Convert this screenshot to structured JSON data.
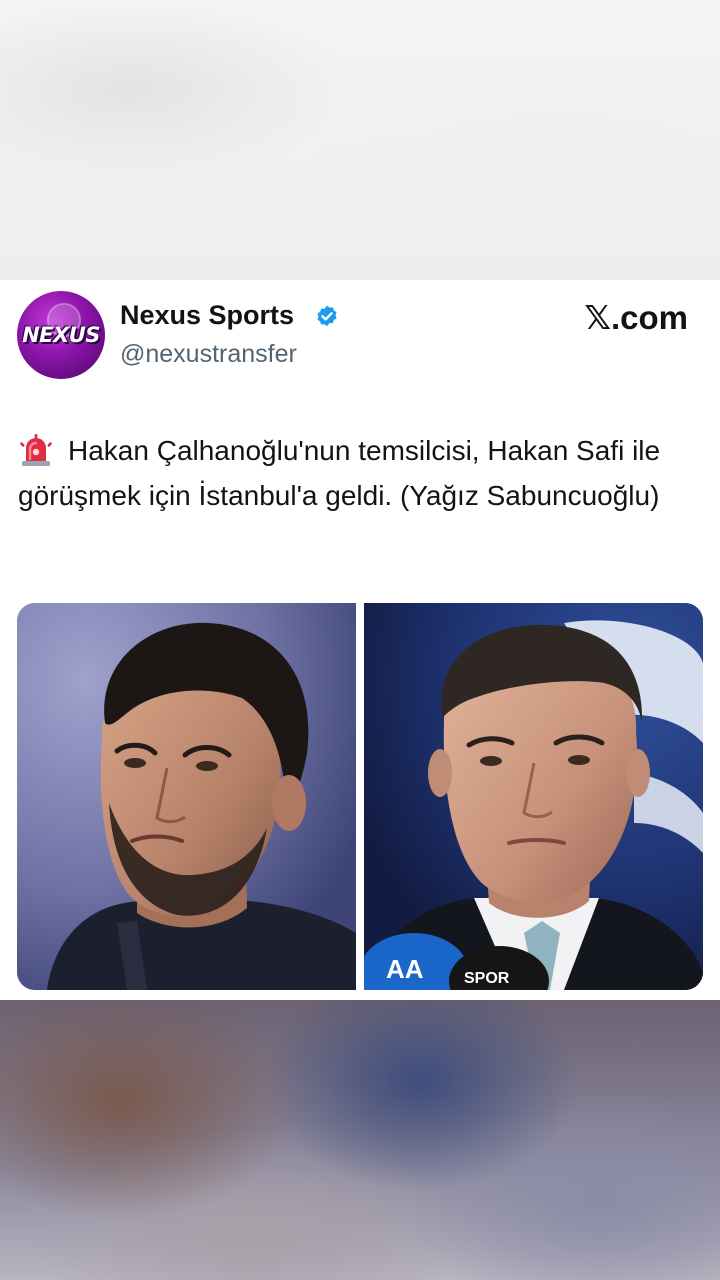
{
  "author": {
    "name": "Nexus Sports",
    "handle": "@nexustransfer",
    "avatar_text": "NEXUS",
    "verified": true
  },
  "site_label": "𝕏.com",
  "tweet": {
    "icon": "siren-icon",
    "text": "Hakan Çalhanoğlu'nun temsilcisi, Hakan Safi ile görüşmek için İstanbul'a geldi. (Yağız Sabuncuoğlu)"
  },
  "media": [
    {
      "name": "photo-left"
    },
    {
      "name": "photo-right",
      "microphone_label_1": "AA",
      "microphone_label_2": "SPOR"
    }
  ],
  "colors": {
    "avatar_purple": "#8a14a8",
    "verified_blue": "#1d9bf0",
    "text_primary": "#0f1419",
    "text_secondary": "#536471",
    "siren_red": "#e0245e"
  }
}
